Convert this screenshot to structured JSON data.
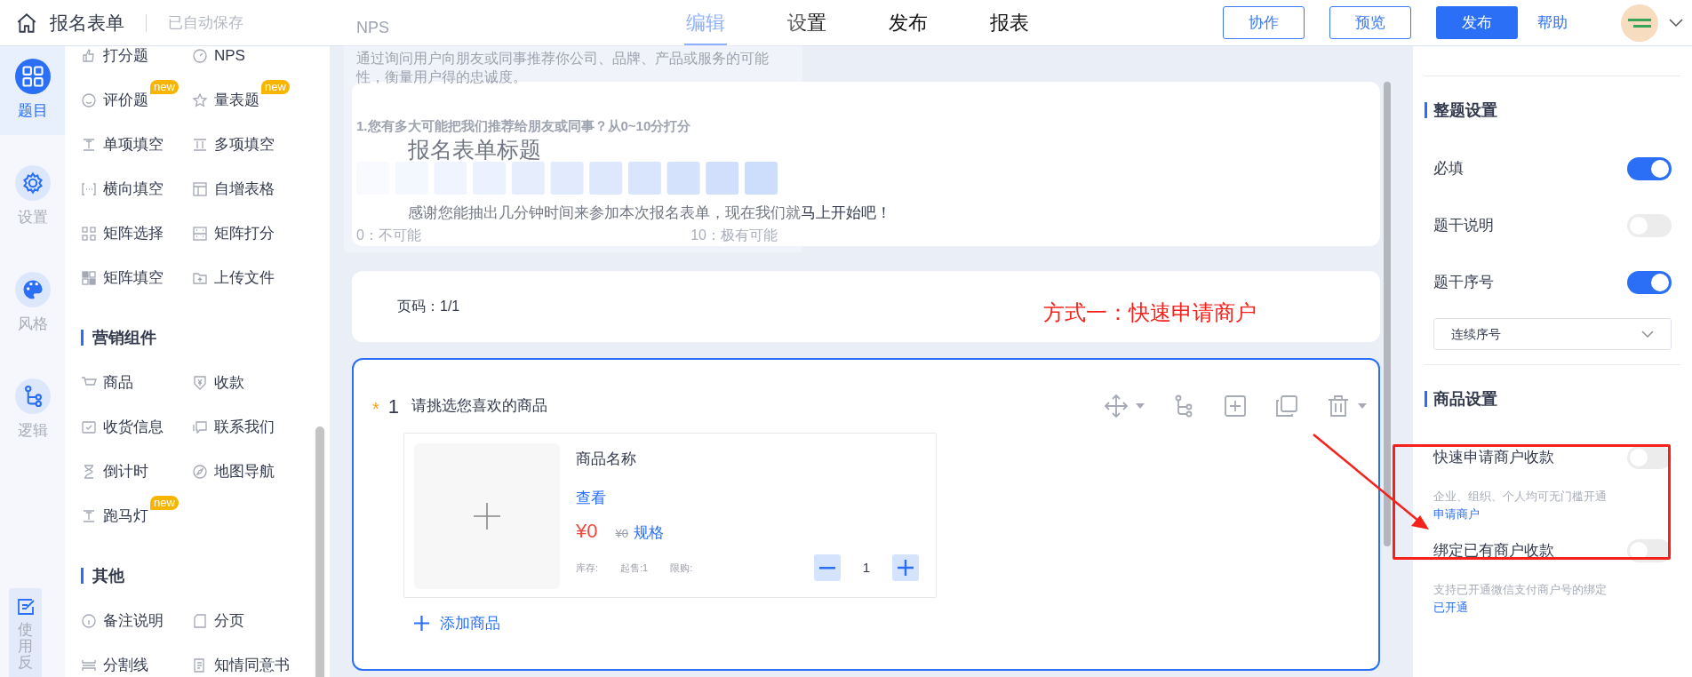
{
  "header": {
    "title": "报名表单",
    "save_status": "已自动保存"
  },
  "tabs": [
    {
      "label": "编辑",
      "selected": true
    },
    {
      "label": "设置",
      "selected": false
    },
    {
      "label": "发布",
      "selected": false
    },
    {
      "label": "报表",
      "selected": false
    }
  ],
  "actions": [
    {
      "label": "协作",
      "kind": "outline"
    },
    {
      "label": "预览",
      "kind": "outline"
    },
    {
      "label": "发布",
      "kind": "primary"
    },
    {
      "label": "帮助",
      "kind": "link"
    }
  ],
  "rail": [
    {
      "label": "题目",
      "kind": "grid",
      "selected": true
    },
    {
      "label": "设置",
      "kind": "gear",
      "selected": false
    },
    {
      "label": "风格",
      "kind": "palette",
      "selected": false
    },
    {
      "label": "逻辑",
      "kind": "branch",
      "selected": false
    }
  ],
  "feedback": "使用反",
  "component_groups": [
    {
      "items": [
        {
          "label": "打分题",
          "kind": "score"
        },
        {
          "label": "NPS",
          "kind": "gauge"
        },
        {
          "label": "评价题",
          "kind": "smile",
          "badge": "new"
        },
        {
          "label": "量表题",
          "kind": "star",
          "badge": "new"
        },
        {
          "label": "单项填空",
          "kind": "blank"
        },
        {
          "label": "多项填空",
          "kind": "blanks"
        },
        {
          "label": "横向填空",
          "kind": "inline"
        },
        {
          "label": "自增表格",
          "kind": "table"
        },
        {
          "label": "矩阵选择",
          "kind": "matrix"
        },
        {
          "label": "矩阵打分",
          "kind": "matrixstar"
        },
        {
          "label": "矩阵填空",
          "kind": "matrixfill"
        },
        {
          "label": "上传文件",
          "kind": "upload"
        }
      ]
    },
    {
      "title": "营销组件",
      "items": [
        {
          "label": "商品",
          "kind": "cart"
        },
        {
          "label": "收款",
          "kind": "yen"
        },
        {
          "label": "收货信息",
          "kind": "box"
        },
        {
          "label": "联系我们",
          "kind": "chat"
        },
        {
          "label": "倒计时",
          "kind": "hourglass"
        },
        {
          "label": "地图导航",
          "kind": "compass"
        },
        {
          "label": "跑马灯",
          "kind": "blank",
          "badge": "new"
        }
      ]
    },
    {
      "title": "其他",
      "items": [
        {
          "label": "备注说明",
          "kind": "info"
        },
        {
          "label": "分页",
          "kind": "page"
        },
        {
          "label": "分割线",
          "kind": "divider"
        },
        {
          "label": "知情同意书",
          "kind": "doc"
        }
      ]
    }
  ],
  "nps_preview": {
    "title": "NPS",
    "description": "通过询问用户向朋友或同事推荐你公司、品牌、产品或服务的可能性，衡量用户得的忠诚度。",
    "question": "1.您有多大可能把我们推荐给朋友或同事？从0~10分打分",
    "low_label": "0：不可能",
    "high_label": "10：极有可能"
  },
  "form_header": {
    "title": "报名表单标题",
    "description": "感谢您能抽出几分钟时间来参加本次报名表单，现在我们就马上开始吧！"
  },
  "pagination": "页码：1/1",
  "annotation": "方式一：快速申请商户",
  "question": {
    "required_mark": "*",
    "number": "1",
    "title": "请挑选您喜欢的商品",
    "product": {
      "name": "商品名称",
      "view_link": "查看",
      "price": "¥0",
      "original_price": "¥0",
      "spec_link": "规格",
      "stock": "库存:",
      "min_order": "起售:1",
      "limit": "限购:",
      "quantity": "1"
    },
    "add_link": "添加商品"
  },
  "settings": [
    {
      "title": "整题设置",
      "rows": [
        {
          "kind": "toggle",
          "label": "必填",
          "on": true
        },
        {
          "kind": "toggle",
          "label": "题干说明",
          "on": false
        },
        {
          "kind": "toggle",
          "label": "题干序号",
          "on": true
        },
        {
          "kind": "select",
          "value": "连续序号"
        }
      ]
    },
    {
      "title": "商品设置",
      "rows": [
        {
          "kind": "toggle",
          "label": "快速申请商户收款",
          "on": false,
          "note": "企业、组织、个人均可无门槛开通",
          "link": "申请商户"
        },
        {
          "kind": "toggle",
          "label": "绑定已有商户收款",
          "on": false,
          "note": "支持已开通微信支付商户号的绑定",
          "link": "已开通"
        }
      ]
    }
  ]
}
